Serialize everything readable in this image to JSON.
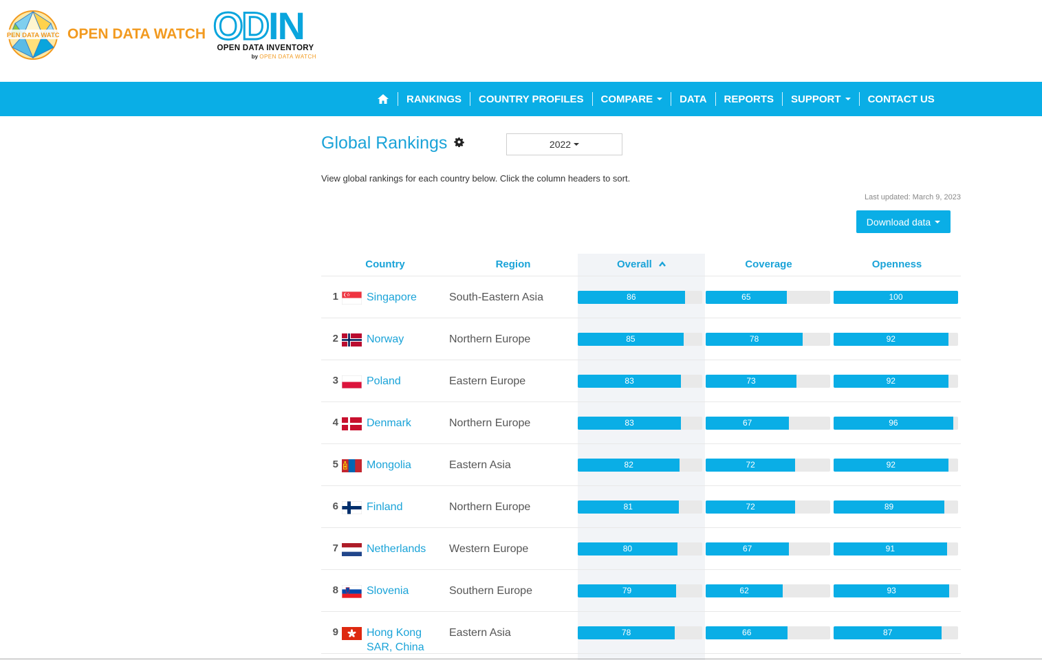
{
  "brand": {
    "odw_text": "OPEN DATA WATCH",
    "odw_badge_text": "OPEN DATA WATCH",
    "odin_word_od": "OD",
    "odin_word_in": "IN",
    "odin_subtitle": "OPEN DATA INVENTORY",
    "odin_by": "by",
    "odin_by_brand": "OPEN DATA WATCH",
    "odw_color": "#f29a1f",
    "odin_color": "#0aa5dd"
  },
  "nav": {
    "home_icon": "home-icon",
    "items": [
      {
        "label": "RANKINGS",
        "dropdown": false
      },
      {
        "label": "COUNTRY PROFILES",
        "dropdown": false
      },
      {
        "label": "COMPARE",
        "dropdown": true
      },
      {
        "label": "DATA",
        "dropdown": false
      },
      {
        "label": "REPORTS",
        "dropdown": false
      },
      {
        "label": "SUPPORT",
        "dropdown": true
      },
      {
        "label": "CONTACT US",
        "dropdown": false
      }
    ],
    "background": "#0aaee6"
  },
  "page": {
    "title": "Global Rankings",
    "settings_icon": "gear-icon",
    "year_selected": "2022",
    "intro": "View global rankings for each country below. Click the column headers to sort.",
    "last_updated": "Last updated: March 9, 2023",
    "download_label": "Download data"
  },
  "table": {
    "headers": {
      "country": "Country",
      "region": "Region",
      "overall": "Overall",
      "coverage": "Coverage",
      "openness": "Openness"
    },
    "sorted_by": "Overall",
    "sort_direction": "ascending-arrow",
    "rows": [
      {
        "rank": "1",
        "country": "Singapore",
        "region": "South-Eastern Asia",
        "overall": 86,
        "coverage": 65,
        "openness": 100,
        "flag": "singapore"
      },
      {
        "rank": "2",
        "country": "Norway",
        "region": "Northern Europe",
        "overall": 85,
        "coverage": 78,
        "openness": 92,
        "flag": "norway"
      },
      {
        "rank": "3",
        "country": "Poland",
        "region": "Eastern Europe",
        "overall": 83,
        "coverage": 73,
        "openness": 92,
        "flag": "poland"
      },
      {
        "rank": "4",
        "country": "Denmark",
        "region": "Northern Europe",
        "overall": 83,
        "coverage": 67,
        "openness": 96,
        "flag": "denmark"
      },
      {
        "rank": "5",
        "country": "Mongolia",
        "region": "Eastern Asia",
        "overall": 82,
        "coverage": 72,
        "openness": 92,
        "flag": "mongolia"
      },
      {
        "rank": "6",
        "country": "Finland",
        "region": "Northern Europe",
        "overall": 81,
        "coverage": 72,
        "openness": 89,
        "flag": "finland"
      },
      {
        "rank": "7",
        "country": "Netherlands",
        "region": "Western Europe",
        "overall": 80,
        "coverage": 67,
        "openness": 91,
        "flag": "netherlands"
      },
      {
        "rank": "8",
        "country": "Slovenia",
        "region": "Southern Europe",
        "overall": 79,
        "coverage": 62,
        "openness": 93,
        "flag": "slovenia"
      },
      {
        "rank": "9",
        "country": "Hong Kong SAR, China",
        "region": "Eastern Asia",
        "overall": 78,
        "coverage": 66,
        "openness": 87,
        "flag": "hong-kong"
      }
    ],
    "bar_color": "#0aaee6",
    "bar_track_color": "#e9e9e9"
  }
}
